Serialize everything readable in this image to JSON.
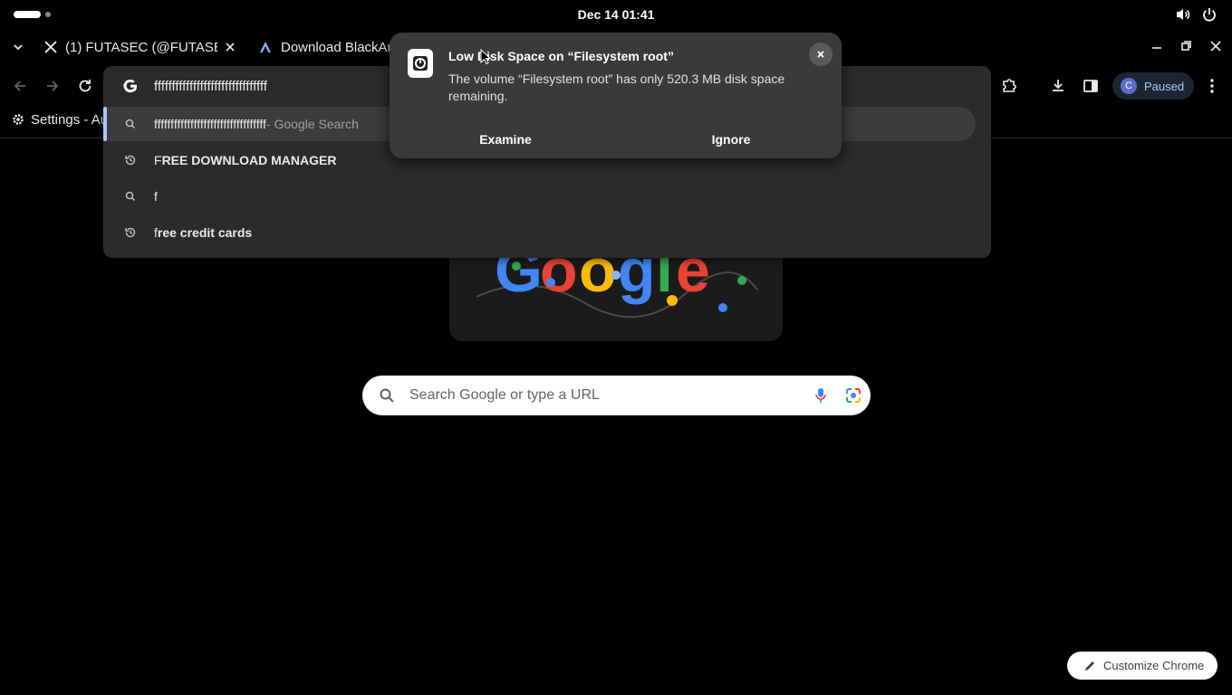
{
  "system": {
    "clock": "Dec 14  01:41"
  },
  "tabs": [
    {
      "title": "(1) FUTASEC (@FUTASEC"
    },
    {
      "title": "Download BlackAr"
    }
  ],
  "bookmarks": {
    "item": "Settings - Au"
  },
  "profile": {
    "initial": "C",
    "status": "Paused"
  },
  "omnibox": {
    "value": "ffffffffffffffffffffffffffffffff",
    "suggestions": [
      {
        "prefix": "ffffffffffffffffffffffffffffffffff",
        "suffix": " - Google Search",
        "icon": "search-icon"
      },
      {
        "prefix": "F",
        "rest": "REE DOWNLOAD MANAGER",
        "icon": "history-icon"
      },
      {
        "prefix": "f",
        "rest": "",
        "icon": "search-icon"
      },
      {
        "prefix": "f",
        "rest": "ree credit cards",
        "icon": "history-icon"
      }
    ]
  },
  "newtab": {
    "search_placeholder": "Search Google or type a URL",
    "customize_label": "Customize Chrome"
  },
  "notification": {
    "title": "Low Disk Space on “Filesystem root”",
    "body": "The volume “Filesystem root” has only 520.3 MB disk space remaining.",
    "examine_label": "Examine",
    "ignore_label": "Ignore"
  },
  "colors": {
    "accent": "#a8c7fa",
    "omnibox_bg": "#2b2b2b",
    "notification_bg": "#3a3a3a"
  }
}
